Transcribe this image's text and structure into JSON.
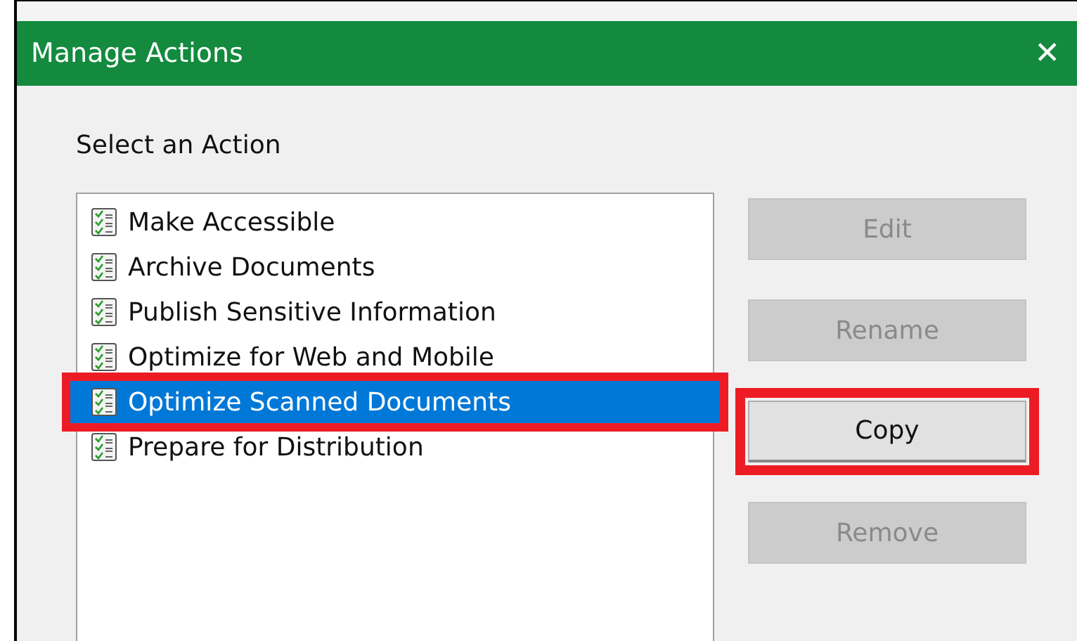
{
  "window": {
    "title": "Manage Actions",
    "close": "✕"
  },
  "prompt": "Select an Action",
  "actions": [
    {
      "label": "Make Accessible",
      "selected": false,
      "highlighted": false
    },
    {
      "label": "Archive Documents",
      "selected": false,
      "highlighted": false
    },
    {
      "label": "Publish Sensitive Information",
      "selected": false,
      "highlighted": false
    },
    {
      "label": "Optimize for Web and Mobile",
      "selected": false,
      "highlighted": false
    },
    {
      "label": "Optimize Scanned Documents",
      "selected": true,
      "highlighted": true
    },
    {
      "label": "Prepare for Distribution",
      "selected": false,
      "highlighted": false
    }
  ],
  "buttons": [
    {
      "label": "Edit",
      "disabled": true,
      "highlighted": false
    },
    {
      "label": "Rename",
      "disabled": true,
      "highlighted": false
    },
    {
      "label": "Copy",
      "disabled": false,
      "highlighted": true
    },
    {
      "label": "Remove",
      "disabled": true,
      "highlighted": false
    }
  ]
}
